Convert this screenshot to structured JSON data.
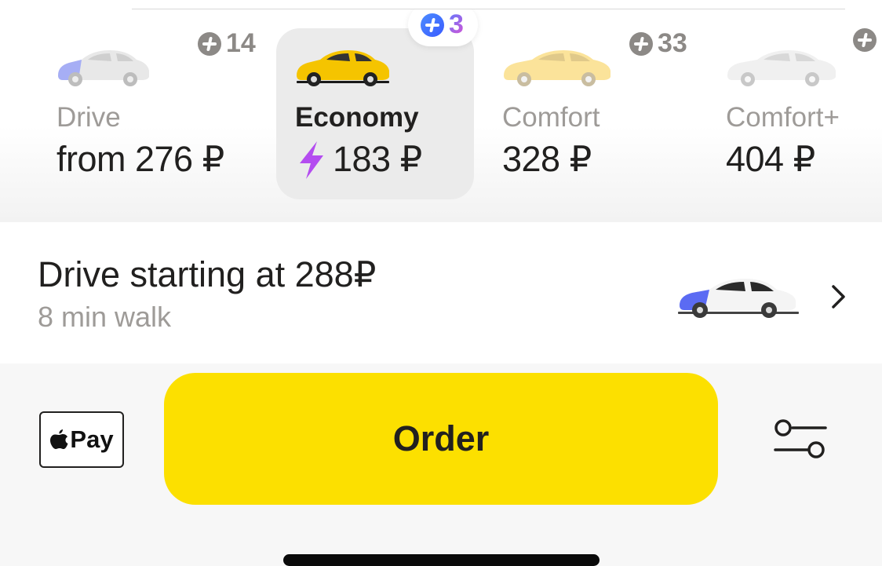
{
  "tariffs": [
    {
      "name": "Drive",
      "price": "from 276 ₽",
      "plus_count": "14"
    },
    {
      "name": "Economy",
      "price": "183 ₽",
      "plus_count": "3"
    },
    {
      "name": "Comfort",
      "price": "328 ₽",
      "plus_count": "33"
    },
    {
      "name": "Comfort+",
      "price": "404 ₽",
      "plus_count": ""
    }
  ],
  "drive_offer": {
    "title": "Drive starting at 288₽",
    "subtitle": "8 min walk"
  },
  "payment": {
    "label": "Pay"
  },
  "order_button": {
    "label": "Order"
  },
  "colors": {
    "accent_yellow": "#fce000",
    "surge_purple": "#b44cf0",
    "drive_blue": "#5b6bf3"
  },
  "icons": [
    "plus-points-icon",
    "lightning-icon",
    "chevron-right-icon",
    "apple-logo-icon",
    "settings-sliders-icon"
  ]
}
